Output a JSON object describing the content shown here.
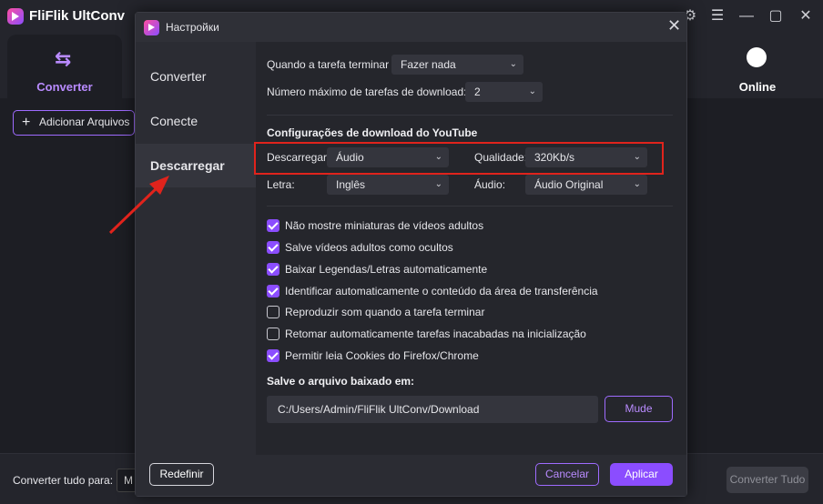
{
  "app": {
    "title": "FliFlik UltConv",
    "tabs": {
      "converter": "Converter",
      "online": "Online"
    },
    "add_files": "Adicionar Arquivos",
    "convert_all_label": "Converter tudo para:",
    "convert_all_value": "M",
    "convert_all_button": "Converter Tudo"
  },
  "dialog": {
    "title": "Настройки",
    "nav": [
      "Converter",
      "Conecte",
      "Descarregar"
    ],
    "active_nav": "Descarregar",
    "when_task_ends_label": "Quando a tarefa terminar",
    "when_task_ends_value": "Fazer nada",
    "max_tasks_label": "Número máximo de tarefas de download:",
    "max_tasks_value": "2",
    "youtube_section": "Configurações de download do YouTube",
    "download_label": "Descarregar:",
    "download_value": "Áudio",
    "quality_label": "Qualidade:",
    "quality_value": "320Kb/s",
    "lyrics_label": "Letra:",
    "lyrics_value": "Inglês",
    "audio_label": "Áudio:",
    "audio_value": "Áudio Original",
    "options": [
      {
        "label": "Não mostre miniaturas de vídeos adultos",
        "checked": true
      },
      {
        "label": "Salve vídeos adultos como ocultos",
        "checked": true
      },
      {
        "label": "Baixar Legendas/Letras automaticamente",
        "checked": true
      },
      {
        "label": "Identificar automaticamente o conteúdo da área de transferência",
        "checked": true
      },
      {
        "label": "Reproduzir som quando a tarefa terminar",
        "checked": false
      },
      {
        "label": "Retomar automaticamente tarefas inacabadas na inicialização",
        "checked": false
      },
      {
        "label": "Permitir leia Cookies do Firefox/Chrome",
        "checked": true
      }
    ],
    "save_section": "Salve o arquivo baixado em:",
    "save_path": "C:/Users/Admin/FliFlik UltConv/Download",
    "change_button": "Mude",
    "reset_button": "Redefinir",
    "cancel_button": "Cancelar",
    "apply_button": "Aplicar"
  },
  "colors": {
    "accent": "#8b4dff",
    "highlight": "#e0231c"
  }
}
